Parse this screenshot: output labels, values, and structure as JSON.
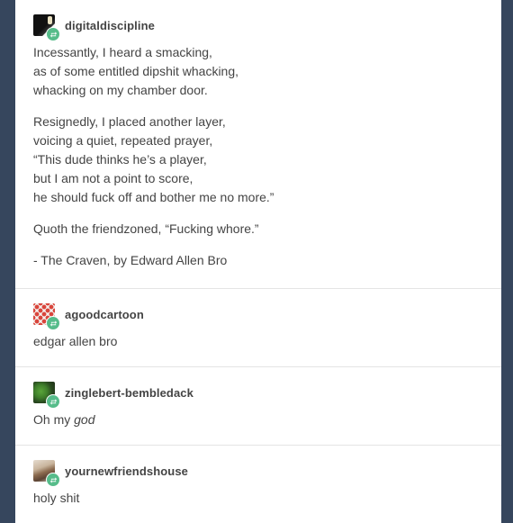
{
  "colors": {
    "background": "#36465d",
    "card": "#ffffff",
    "text": "#444444",
    "reblog_badge": "#56bc8a",
    "divider": "#e4e4e4"
  },
  "posts": [
    {
      "username": "digitaldiscipline",
      "icon": "reblog-icon",
      "paragraphs": [
        [
          "Incessantly, I heard a smacking,",
          "as of some entitled dipshit whacking,",
          "whacking on my chamber door."
        ],
        [
          "Resignedly, I placed another layer,",
          "voicing a quiet, repeated prayer,",
          "“This dude thinks he’s a player,",
          "but I am not a point to score,",
          "he should fuck off and bother me no more.”"
        ],
        [
          "Quoth the friendzoned, “Fucking whore.”"
        ],
        [
          "- The Craven, by Edward Allen Bro"
        ]
      ]
    },
    {
      "username": "agoodcartoon",
      "icon": "reblog-icon",
      "text": "edgar allen bro"
    },
    {
      "username": "zinglebert-bembledack",
      "icon": "reblog-icon",
      "text_plain": "Oh my ",
      "text_italic": "god"
    },
    {
      "username": "yournewfriendshouse",
      "icon": "reblog-icon",
      "text": "holy shit"
    }
  ]
}
